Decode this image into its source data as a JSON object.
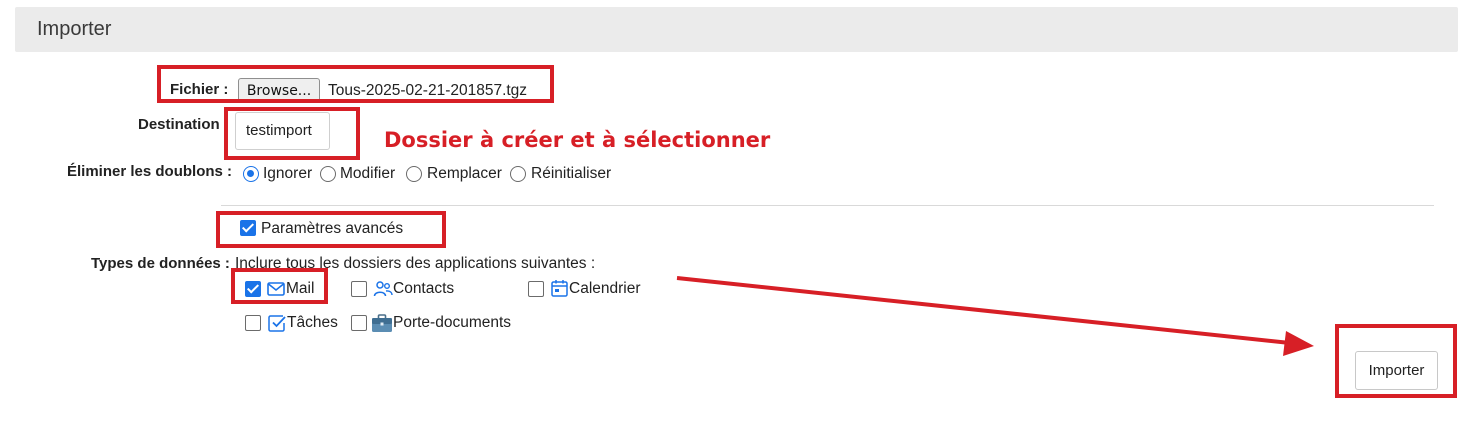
{
  "header": {
    "title": "Importer"
  },
  "form": {
    "file_label": "Fichier :",
    "browse_label": "Browse...",
    "file_name": "Tous-2025-02-21-201857.tgz",
    "destination_label": "Destination",
    "destination_value": "testimport",
    "duplicates_label": "Éliminer les doublons :",
    "duplicates_options": [
      "Ignorer",
      "Modifier",
      "Remplacer",
      "Réinitialiser"
    ],
    "duplicates_selected": "Ignorer",
    "advanced_label": "Paramètres avancés",
    "advanced_checked": true,
    "data_types_label": "Types de données :",
    "data_types_hint": "Inclure tous les dossiers des applications suivantes :",
    "apps": [
      {
        "label": "Mail",
        "checked": true,
        "icon": "mail-icon"
      },
      {
        "label": "Contacts",
        "checked": false,
        "icon": "contacts-icon"
      },
      {
        "label": "Calendrier",
        "checked": false,
        "icon": "calendar-icon"
      },
      {
        "label": "Tâches",
        "checked": false,
        "icon": "tasks-icon"
      },
      {
        "label": "Porte-documents",
        "checked": false,
        "icon": "briefcase-icon"
      }
    ],
    "submit_label": "Importer"
  },
  "annotation": {
    "text": "Dossier à créer et à sélectionner",
    "color": "#d71f26"
  },
  "colors": {
    "accent": "#1a73e8",
    "annotation_red": "#d71f26",
    "header_bg": "#ebebeb"
  }
}
